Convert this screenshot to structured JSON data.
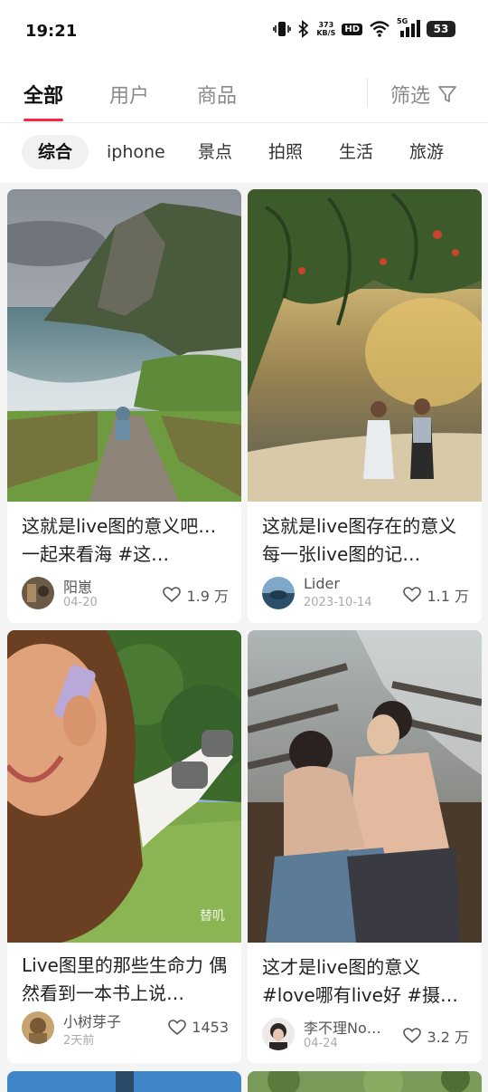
{
  "status": {
    "time": "19:21",
    "net_speed_top": "373",
    "net_speed_bottom": "KB/S",
    "hd": "HD",
    "signal": "5G",
    "battery": "53"
  },
  "tabs": [
    {
      "label": "全部"
    },
    {
      "label": "用户"
    },
    {
      "label": "商品"
    }
  ],
  "filter_label": "筛选",
  "chips": [
    {
      "label": "综合"
    },
    {
      "label": "iphone"
    },
    {
      "label": "景点"
    },
    {
      "label": "拍照"
    },
    {
      "label": "生活"
    },
    {
      "label": "旅游"
    }
  ],
  "cards": [
    {
      "title": "这就是live图的意义吧… 一起来看海 #这…",
      "author": "阳崽",
      "date": "04-20",
      "likes": "1.9 万"
    },
    {
      "title": "这就是live图存在的意义 每一张live图的记…",
      "author": "Lider",
      "date": "2023-10-14",
      "likes": "1.1 万"
    },
    {
      "title": "Live图里的那些生命力 偶然看到一本书上说…",
      "author": "小树芽子",
      "date": "2天前",
      "likes": "1453",
      "watermark": "替叽"
    },
    {
      "title": "这才是live图的意义 #love哪有live好 #摄…",
      "author": "李不理No…",
      "date": "04-24",
      "likes": "3.2 万"
    }
  ]
}
